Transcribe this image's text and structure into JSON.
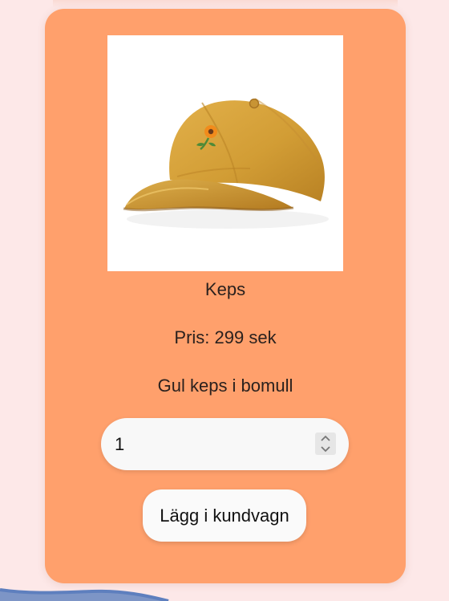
{
  "product": {
    "name": "Keps",
    "price": "Pris: 299 sek",
    "description": "Gul keps i bomull",
    "image": "yellow-baseball-cap-with-sunflower"
  },
  "quantity": {
    "value": "1"
  },
  "actions": {
    "add_to_cart_label": "Lägg i kundvagn"
  },
  "colors": {
    "page_background": "#fde8e8",
    "card_background": "#ffa06c",
    "input_background": "#f8f8f8",
    "button_background": "#fafafa",
    "wave": "#7d95c6",
    "cap": "#d5a13d"
  },
  "icons": {
    "stepper": "number-stepper-icon"
  }
}
